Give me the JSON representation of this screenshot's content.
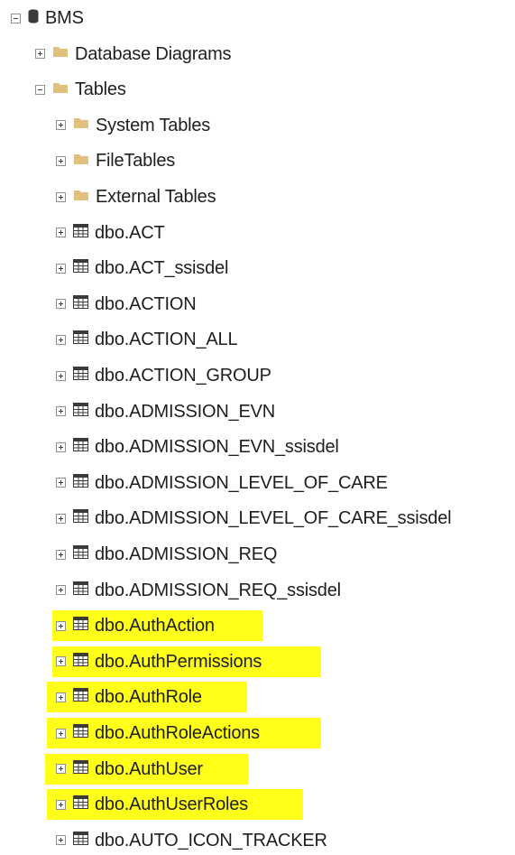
{
  "colors": {
    "highlight": "#ffff1a",
    "folder": "#e2c07e",
    "table_icon": "#3a3a3a"
  },
  "tree": [
    {
      "label": "BMS",
      "level": 0,
      "expanded": true,
      "icon": "database-icon"
    },
    {
      "label": "Database Diagrams",
      "level": 1,
      "expanded": false,
      "icon": "folder-icon"
    },
    {
      "label": "Tables",
      "level": 1,
      "expanded": true,
      "icon": "folder-icon"
    },
    {
      "label": "System Tables",
      "level": 2,
      "expanded": false,
      "icon": "folder-icon"
    },
    {
      "label": "FileTables",
      "level": 2,
      "expanded": false,
      "icon": "folder-icon"
    },
    {
      "label": "External Tables",
      "level": 2,
      "expanded": false,
      "icon": "folder-icon"
    },
    {
      "label": "dbo.ACT",
      "level": 2,
      "expanded": false,
      "icon": "table-icon"
    },
    {
      "label": "dbo.ACT_ssisdel",
      "level": 2,
      "expanded": false,
      "icon": "table-icon"
    },
    {
      "label": "dbo.ACTION",
      "level": 2,
      "expanded": false,
      "icon": "table-icon"
    },
    {
      "label": "dbo.ACTION_ALL",
      "level": 2,
      "expanded": false,
      "icon": "table-icon"
    },
    {
      "label": "dbo.ACTION_GROUP",
      "level": 2,
      "expanded": false,
      "icon": "table-icon"
    },
    {
      "label": "dbo.ADMISSION_EVN",
      "level": 2,
      "expanded": false,
      "icon": "table-icon"
    },
    {
      "label": "dbo.ADMISSION_EVN_ssisdel",
      "level": 2,
      "expanded": false,
      "icon": "table-icon"
    },
    {
      "label": "dbo.ADMISSION_LEVEL_OF_CARE",
      "level": 2,
      "expanded": false,
      "icon": "table-icon"
    },
    {
      "label": "dbo.ADMISSION_LEVEL_OF_CARE_ssisdel",
      "level": 2,
      "expanded": false,
      "icon": "table-icon"
    },
    {
      "label": "dbo.ADMISSION_REQ",
      "level": 2,
      "expanded": false,
      "icon": "table-icon"
    },
    {
      "label": "dbo.ADMISSION_REQ_ssisdel",
      "level": 2,
      "expanded": false,
      "icon": "table-icon"
    },
    {
      "label": "dbo.AuthAction",
      "level": 2,
      "expanded": false,
      "icon": "table-icon",
      "highlighted": true
    },
    {
      "label": "dbo.AuthPermissions",
      "level": 2,
      "expanded": false,
      "icon": "table-icon",
      "highlighted": true
    },
    {
      "label": "dbo.AuthRole",
      "level": 2,
      "expanded": false,
      "icon": "table-icon",
      "highlighted": true
    },
    {
      "label": "dbo.AuthRoleActions",
      "level": 2,
      "expanded": false,
      "icon": "table-icon",
      "highlighted": true
    },
    {
      "label": "dbo.AuthUser",
      "level": 2,
      "expanded": false,
      "icon": "table-icon",
      "highlighted": true
    },
    {
      "label": "dbo.AuthUserRoles",
      "level": 2,
      "expanded": false,
      "icon": "table-icon",
      "highlighted": true
    },
    {
      "label": "dbo.AUTO_ICON_TRACKER",
      "level": 2,
      "expanded": false,
      "icon": "table-icon"
    }
  ]
}
